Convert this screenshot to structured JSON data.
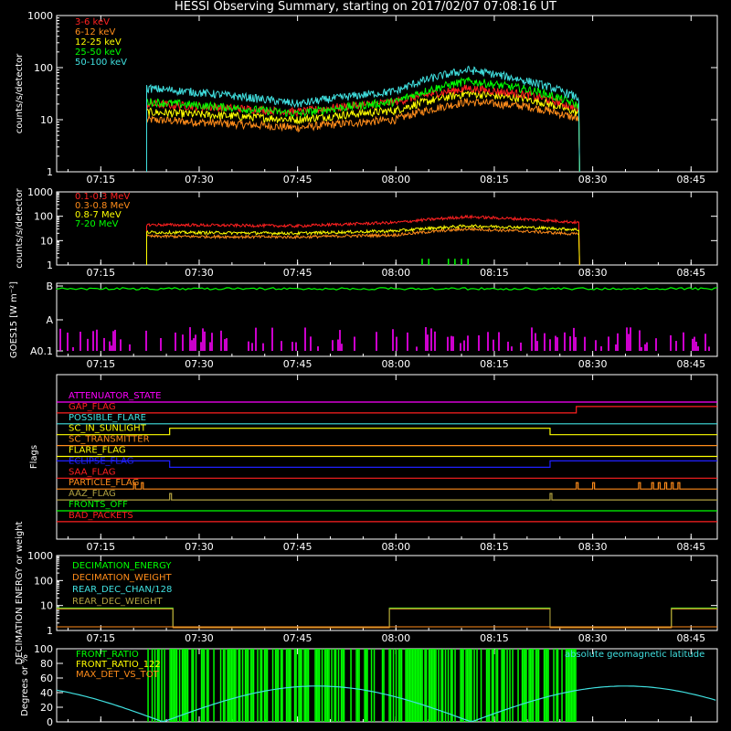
{
  "title": "HESSI Observing Summary, starting on 2017/02/07 07:08:16 UT",
  "time_ticks": [
    "07:15",
    "07:30",
    "07:45",
    "08:00",
    "08:15",
    "08:30",
    "08:45"
  ],
  "colors": {
    "white": "#ffffff",
    "red": "#ff2020",
    "orange": "#ff8c1a",
    "yellow": "#ffff00",
    "green": "#00ff00",
    "cyan": "#40e0e0",
    "magenta": "#ff00ff",
    "blue": "#2020ff",
    "khaki": "#b0a040"
  },
  "chart_data": [
    {
      "type": "line",
      "ylabel": "counts/s/detector",
      "yscale": "log",
      "ylim": [
        1,
        1000
      ],
      "ytick_labels": [
        "1",
        "10",
        "100",
        "1000"
      ],
      "x_start": "07:08:16",
      "x_end": "08:49",
      "legend_position": "top-left",
      "series": [
        {
          "name": "3-6 keV",
          "color": "#ff2020",
          "x": [
            "07:22",
            "07:45",
            "08:00",
            "08:11",
            "08:20",
            "08:28"
          ],
          "values": [
            20,
            14,
            22,
            40,
            30,
            16
          ]
        },
        {
          "name": "6-12 keV",
          "color": "#ff8c1a",
          "x": [
            "07:22",
            "07:45",
            "08:00",
            "08:11",
            "08:20",
            "08:28"
          ],
          "values": [
            10,
            7,
            10,
            22,
            18,
            10
          ]
        },
        {
          "name": "12-25 keV",
          "color": "#ffff00",
          "x": [
            "07:22",
            "07:45",
            "08:00",
            "08:11",
            "08:20",
            "08:28"
          ],
          "values": [
            14,
            10,
            15,
            32,
            25,
            13
          ]
        },
        {
          "name": "25-50 keV",
          "color": "#00ff00",
          "x": [
            "07:22",
            "07:45",
            "08:00",
            "08:11",
            "08:20",
            "08:28"
          ],
          "values": [
            22,
            13,
            22,
            55,
            38,
            18
          ]
        },
        {
          "name": "50-100 keV",
          "color": "#40e0e0",
          "x": [
            "07:22",
            "07:45",
            "08:00",
            "08:11",
            "08:20",
            "08:28"
          ],
          "values": [
            40,
            20,
            35,
            90,
            55,
            25
          ]
        }
      ]
    },
    {
      "type": "line",
      "ylabel": "counts/s/detector",
      "yscale": "log",
      "ylim": [
        1,
        1000
      ],
      "ytick_labels": [
        "1",
        "10",
        "100",
        "1000"
      ],
      "legend_position": "top-left",
      "series": [
        {
          "name": "0.1-0.3 MeV",
          "color": "#ff2020",
          "x": [
            "07:22",
            "07:45",
            "08:00",
            "08:11",
            "08:20",
            "08:28"
          ],
          "values": [
            45,
            40,
            55,
            95,
            75,
            55
          ]
        },
        {
          "name": "0.3-0.8 MeV",
          "color": "#ff8c1a",
          "x": [
            "07:22",
            "07:45",
            "08:00",
            "08:11",
            "08:20",
            "08:28"
          ],
          "values": [
            15,
            14,
            17,
            30,
            24,
            18
          ]
        },
        {
          "name": "0.8-7 MeV",
          "color": "#ffff00",
          "x": [
            "07:22",
            "07:45",
            "08:00",
            "08:11",
            "08:20",
            "08:28"
          ],
          "values": [
            22,
            20,
            25,
            40,
            35,
            28
          ]
        },
        {
          "name": "7-20 MeV",
          "color": "#00ff00",
          "x": [
            "08:04",
            "08:05",
            "08:08",
            "08:09",
            "08:10",
            "08:11"
          ],
          "values": [
            1.8,
            1.8,
            1.8,
            1.8,
            1.8,
            1.8
          ]
        }
      ]
    },
    {
      "type": "line",
      "ylabel": "GOES15 [W m⁻²]",
      "ytick_labels": [
        "A0.1",
        "A",
        "B"
      ],
      "series": [
        {
          "name": "",
          "color": "#00ff00",
          "x": [
            "07:08",
            "08:49"
          ],
          "values": [
            "B",
            "B"
          ]
        }
      ],
      "bars_color": "#ff00ff"
    },
    {
      "type": "line",
      "ylabel": "Flags",
      "flags": [
        {
          "name": "ATTENUATOR_STATE",
          "color": "#ff00ff"
        },
        {
          "name": "GAP_FLAG",
          "color": "#ff2020"
        },
        {
          "name": "POSSIBLE_FLARE",
          "color": "#40e0e0"
        },
        {
          "name": "SC_IN_SUNLIGHT",
          "color": "#ffff00"
        },
        {
          "name": "SC_TRANSMITTER",
          "color": "#ff8c1a"
        },
        {
          "name": "FLARE_FLAG",
          "color": "#ffff00"
        },
        {
          "name": "ECLIPSE_FLAG",
          "color": "#2020ff"
        },
        {
          "name": "SAA_FLAG",
          "color": "#ff2020"
        },
        {
          "name": "PARTICLE_FLAG",
          "color": "#ff8c1a"
        },
        {
          "name": "AAZ_FLAG",
          "color": "#b0a040"
        },
        {
          "name": "FRONTS_OFF",
          "color": "#00ff00"
        },
        {
          "name": "BAD_PACKETS",
          "color": "#ff2020"
        }
      ]
    },
    {
      "type": "line",
      "ylabel": "DECIMATION ENERGY or weight",
      "yscale": "log",
      "ylim": [
        1,
        1000
      ],
      "ytick_labels": [
        "1",
        "10",
        "100",
        "1000"
      ],
      "series": [
        {
          "name": "DECIMATION_ENERGY",
          "color": "#00ff00"
        },
        {
          "name": "DECIMATION_WEIGHT",
          "color": "#ff8c1a"
        },
        {
          "name": "REAR_DEC_CHAN/128",
          "color": "#40e0e0"
        },
        {
          "name": "REAR_DEC_WEIGHT",
          "color": "#b0a040"
        }
      ]
    },
    {
      "type": "line",
      "ylabel": "Degrees or %",
      "ylim": [
        0,
        100
      ],
      "ytick_labels": [
        "0",
        "20",
        "40",
        "60",
        "80",
        "100"
      ],
      "series": [
        {
          "name": "FRONT_RATIO",
          "color": "#00ff00"
        },
        {
          "name": "FRONT_RATIO_122",
          "color": "#ffff00"
        },
        {
          "name": "MAX_DET_VS_TOT",
          "color": "#ff8c1a"
        },
        {
          "name": "absolute geomagnetic latitude",
          "color": "#40e0e0"
        }
      ]
    }
  ]
}
